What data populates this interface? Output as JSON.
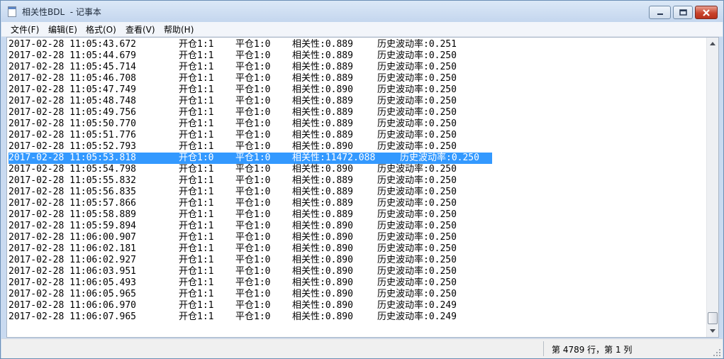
{
  "window": {
    "title": "相关性BDL  - 记事本"
  },
  "window_controls": {
    "minimize": "minimize-icon",
    "maximize": "maximize-icon",
    "close": "close-icon"
  },
  "menu": [
    "文件(F)",
    "编辑(E)",
    "格式(O)",
    "查看(V)",
    "帮助(H)"
  ],
  "lines": [
    {
      "ts": "2017-02-28 11:05:43.672",
      "open": "开仓1:1",
      "close": "平仓1:0",
      "corr": "相关性:0.889",
      "vol": "历史波动率:0.251"
    },
    {
      "ts": "2017-02-28 11:05:44.679",
      "open": "开仓1:1",
      "close": "平仓1:0",
      "corr": "相关性:0.889",
      "vol": "历史波动率:0.250"
    },
    {
      "ts": "2017-02-28 11:05:45.714",
      "open": "开仓1:1",
      "close": "平仓1:0",
      "corr": "相关性:0.889",
      "vol": "历史波动率:0.250"
    },
    {
      "ts": "2017-02-28 11:05:46.708",
      "open": "开仓1:1",
      "close": "平仓1:0",
      "corr": "相关性:0.889",
      "vol": "历史波动率:0.250"
    },
    {
      "ts": "2017-02-28 11:05:47.749",
      "open": "开仓1:1",
      "close": "平仓1:0",
      "corr": "相关性:0.890",
      "vol": "历史波动率:0.250"
    },
    {
      "ts": "2017-02-28 11:05:48.748",
      "open": "开仓1:1",
      "close": "平仓1:0",
      "corr": "相关性:0.889",
      "vol": "历史波动率:0.250"
    },
    {
      "ts": "2017-02-28 11:05:49.756",
      "open": "开仓1:1",
      "close": "平仓1:0",
      "corr": "相关性:0.889",
      "vol": "历史波动率:0.250"
    },
    {
      "ts": "2017-02-28 11:05:50.770",
      "open": "开仓1:1",
      "close": "平仓1:0",
      "corr": "相关性:0.889",
      "vol": "历史波动率:0.250"
    },
    {
      "ts": "2017-02-28 11:05:51.776",
      "open": "开仓1:1",
      "close": "平仓1:0",
      "corr": "相关性:0.889",
      "vol": "历史波动率:0.250"
    },
    {
      "ts": "2017-02-28 11:05:52.793",
      "open": "开仓1:1",
      "close": "平仓1:0",
      "corr": "相关性:0.890",
      "vol": "历史波动率:0.250"
    },
    {
      "ts": "2017-02-28 11:05:53.818",
      "open": "开仓1:0",
      "close": "平仓1:0",
      "corr": "相关性:11472.088",
      "vol": "历史波动率:0.250",
      "selected": true
    },
    {
      "ts": "2017-02-28 11:05:54.798",
      "open": "开仓1:1",
      "close": "平仓1:0",
      "corr": "相关性:0.890",
      "vol": "历史波动率:0.250"
    },
    {
      "ts": "2017-02-28 11:05:55.832",
      "open": "开仓1:1",
      "close": "平仓1:0",
      "corr": "相关性:0.889",
      "vol": "历史波动率:0.250"
    },
    {
      "ts": "2017-02-28 11:05:56.835",
      "open": "开仓1:1",
      "close": "平仓1:0",
      "corr": "相关性:0.889",
      "vol": "历史波动率:0.250"
    },
    {
      "ts": "2017-02-28 11:05:57.866",
      "open": "开仓1:1",
      "close": "平仓1:0",
      "corr": "相关性:0.889",
      "vol": "历史波动率:0.250"
    },
    {
      "ts": "2017-02-28 11:05:58.889",
      "open": "开仓1:1",
      "close": "平仓1:0",
      "corr": "相关性:0.889",
      "vol": "历史波动率:0.250"
    },
    {
      "ts": "2017-02-28 11:05:59.894",
      "open": "开仓1:1",
      "close": "平仓1:0",
      "corr": "相关性:0.890",
      "vol": "历史波动率:0.250"
    },
    {
      "ts": "2017-02-28 11:06:00.907",
      "open": "开仓1:1",
      "close": "平仓1:0",
      "corr": "相关性:0.890",
      "vol": "历史波动率:0.250"
    },
    {
      "ts": "2017-02-28 11:06:02.181",
      "open": "开仓1:1",
      "close": "平仓1:0",
      "corr": "相关性:0.890",
      "vol": "历史波动率:0.250"
    },
    {
      "ts": "2017-02-28 11:06:02.927",
      "open": "开仓1:1",
      "close": "平仓1:0",
      "corr": "相关性:0.890",
      "vol": "历史波动率:0.250"
    },
    {
      "ts": "2017-02-28 11:06:03.951",
      "open": "开仓1:1",
      "close": "平仓1:0",
      "corr": "相关性:0.890",
      "vol": "历史波动率:0.250"
    },
    {
      "ts": "2017-02-28 11:06:05.493",
      "open": "开仓1:1",
      "close": "平仓1:0",
      "corr": "相关性:0.890",
      "vol": "历史波动率:0.250"
    },
    {
      "ts": "2017-02-28 11:06:05.965",
      "open": "开仓1:1",
      "close": "平仓1:0",
      "corr": "相关性:0.890",
      "vol": "历史波动率:0.250"
    },
    {
      "ts": "2017-02-28 11:06:06.970",
      "open": "开仓1:1",
      "close": "平仓1:0",
      "corr": "相关性:0.890",
      "vol": "历史波动率:0.249"
    },
    {
      "ts": "2017-02-28 11:06:07.965",
      "open": "开仓1:1",
      "close": "平仓1:0",
      "corr": "相关性:0.890",
      "vol": "历史波动率:0.249"
    }
  ],
  "status": {
    "position": "第 4789 行，第 1 列"
  },
  "colors": {
    "selection": "#3399ff",
    "titlebar": "#c4d6ee",
    "close_button": "#c9442d"
  }
}
